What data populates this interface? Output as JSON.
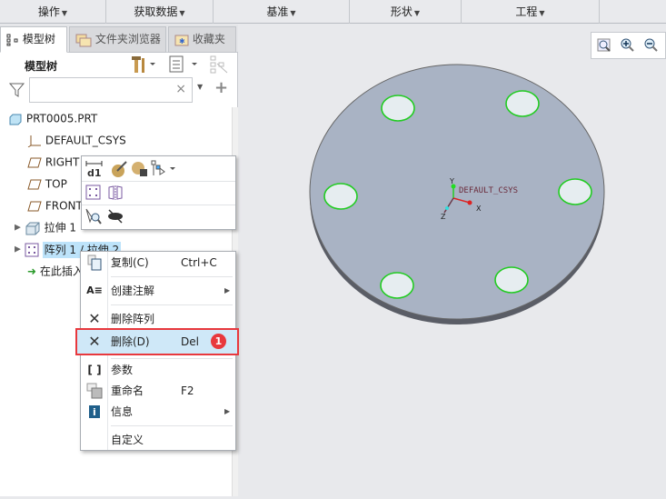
{
  "menubar": [
    {
      "label": "操作"
    },
    {
      "label": "获取数据"
    },
    {
      "label": "基准"
    },
    {
      "label": "形状"
    },
    {
      "label": "工程"
    }
  ],
  "tabs": {
    "model_tree": "模型树",
    "file_browser": "文件夹浏览器",
    "favorites": "收藏夹"
  },
  "panel": {
    "title": "模型树",
    "filter_value": "",
    "clear": "×",
    "add": "+"
  },
  "tree": [
    {
      "label": "PRT0005.PRT"
    },
    {
      "label": "DEFAULT_CSYS"
    },
    {
      "label": "RIGHT"
    },
    {
      "label": "TOP"
    },
    {
      "label": "FRONT"
    },
    {
      "label": "拉伸 1"
    },
    {
      "label": "阵列 1 / 拉伸 2"
    },
    {
      "label": "在此插入"
    }
  ],
  "context_menu": {
    "copy": {
      "label": "复制(C)",
      "shortcut": "Ctrl+C"
    },
    "annotate": {
      "label": "创建注解"
    },
    "delete_pattern": {
      "label": "删除阵列"
    },
    "delete": {
      "label": "删除(D)",
      "shortcut": "Del",
      "badge": "1"
    },
    "params": {
      "label": "参数"
    },
    "rename": {
      "label": "重命名",
      "shortcut": "F2"
    },
    "info": {
      "label": "信息"
    },
    "customize": {
      "label": "自定义"
    }
  },
  "viewport": {
    "csys_label": "DEFAULT_CSYS",
    "x": "X",
    "y": "Y",
    "z": "Z"
  },
  "colors": {
    "highlight": "#cfe8f8",
    "callout": "#e8383d",
    "part": "#a9b3c4"
  }
}
